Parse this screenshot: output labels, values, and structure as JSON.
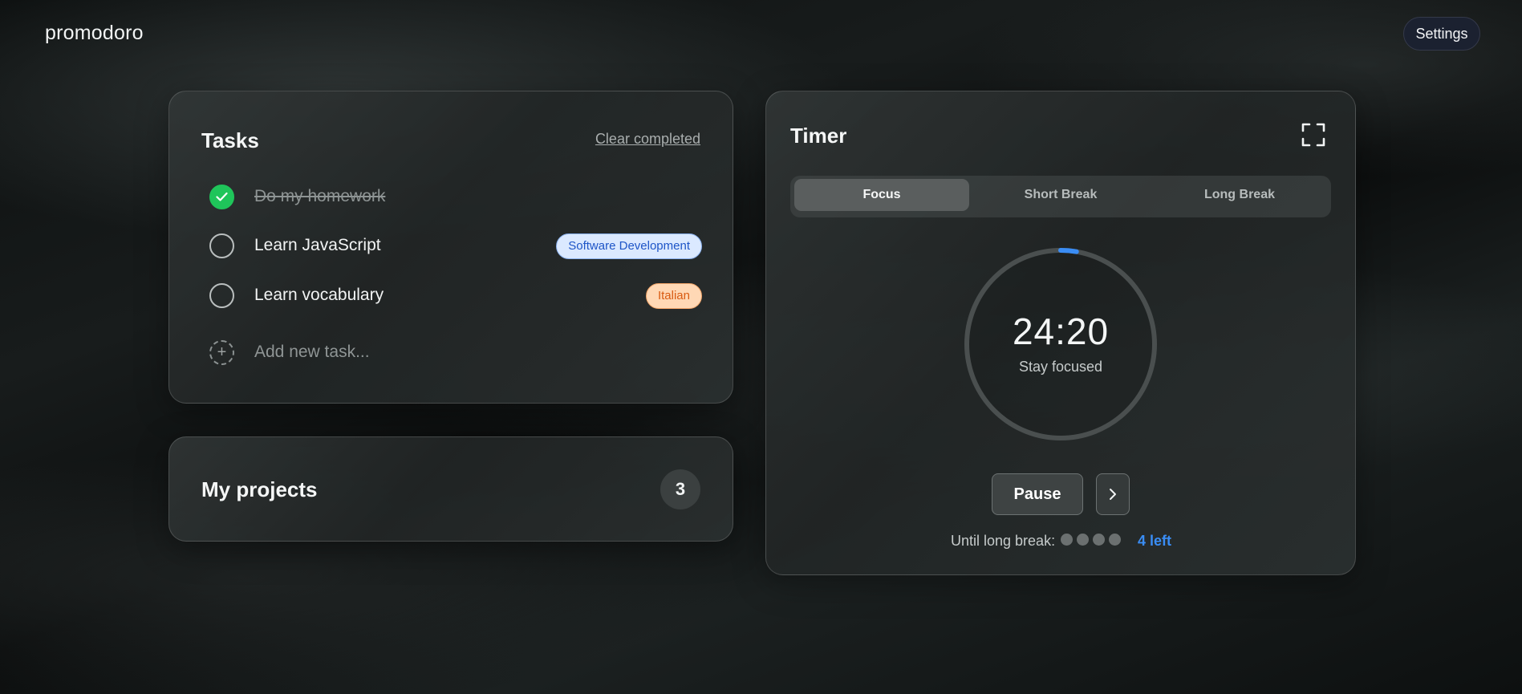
{
  "app": {
    "brand": "promodoro",
    "settings_label": "Settings"
  },
  "tasks": {
    "title": "Tasks",
    "clear_label": "Clear completed",
    "items": [
      {
        "text": "Do my homework",
        "completed": true,
        "tag": ""
      },
      {
        "text": "Learn JavaScript",
        "completed": false,
        "tag": "Software Development",
        "tag_color": "#1e55c7"
      },
      {
        "text": "Learn vocabulary",
        "completed": false,
        "tag": "Italian",
        "tag_color": "#d95b12"
      }
    ],
    "add_placeholder": "Add new task..."
  },
  "projects": {
    "title": "My projects",
    "count": "3"
  },
  "timer": {
    "title": "Timer",
    "fullscreen_icon": "fullscreen-icon",
    "modes": [
      {
        "label": "Focus",
        "active": true
      },
      {
        "label": "Short Break",
        "active": false
      },
      {
        "label": "Long Break",
        "active": false
      }
    ],
    "time": "24:20",
    "status": "Stay focused",
    "progress": 0.027,
    "progress_color": "#3a8df5",
    "pause_label": "Pause",
    "until_label": "Until long break:",
    "sessions_total": 4,
    "sessions_done": 0,
    "left_label": "4 left"
  }
}
